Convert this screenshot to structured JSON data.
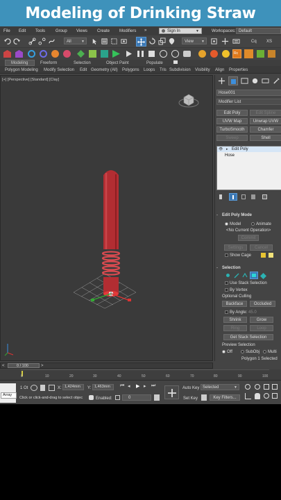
{
  "banner": {
    "title": "Modeling of Drinking Straw"
  },
  "menu": {
    "items": [
      "File",
      "Edit",
      "Tools",
      "Group",
      "Views",
      "Create",
      "Modifiers"
    ],
    "overflow": "»",
    "signin": "Sign In",
    "workspaces_label": "Workspaces:",
    "workspaces_value": "Default"
  },
  "toolbar": {
    "selection_filter": "All",
    "view_dropdown": "View",
    "coord_label": "3",
    "snap_label": "Cq",
    "xs_label": "XS",
    "rc_label": "Rc"
  },
  "ribbon": {
    "tabs": [
      "Modeling",
      "Freeform",
      "Selection",
      "Object Paint",
      "Populate"
    ],
    "subtabs": [
      "Polygon Modeling",
      "Modify Selection",
      "Edit",
      "Geometry (All)",
      "Polygons",
      "Loops",
      "Tris",
      "Subdivision",
      "Visibility",
      "Align",
      "Properties"
    ]
  },
  "viewport": {
    "label": "[+] [Perspective] [Standard] [Clay]",
    "object_color": "#b22d32"
  },
  "panel": {
    "object_name": "Hose001",
    "modifier_list": "Modifier List",
    "modifier_buttons": [
      "Edit Poly",
      "Edit Spline",
      "UVW Map",
      "Unwrap UVW",
      "TurboSmooth",
      "Chamfer",
      "Sweep",
      "Shell"
    ],
    "stack": [
      "Edit Poly",
      "Hose"
    ],
    "edit_poly_mode": {
      "title": "Edit Poly Mode",
      "model": "Model",
      "animate": "Animate",
      "no_op": "<No Current Operation>",
      "commit": "Commit",
      "settings": "Settings",
      "cancel": "Cancel",
      "show_cage": "Show Cage"
    },
    "selection": {
      "title": "Selection",
      "use_stack": "Use Stack Selection",
      "by_vertex": "By Vertex",
      "optional_culling": "Optional Culling",
      "backface": "Backface",
      "occluded": "Occluded",
      "by_angle": "By Angle:",
      "angle_value": "45.0",
      "shrink": "Shrink",
      "grow": "Grow",
      "ring": "Ring",
      "loop": "Loop",
      "get_stack": "Get Stack Selection",
      "preview": "Preview Selection",
      "off": "Off",
      "subobj": "SubObj",
      "multi": "Multi",
      "status": "Polygon 1 Selected"
    }
  },
  "timeline": {
    "frame": "0 / 100",
    "ticks": [
      "0",
      "10",
      "20",
      "30",
      "40",
      "50",
      "60",
      "70",
      "80",
      "90",
      "100"
    ]
  },
  "status": {
    "selected": "1 Ot",
    "script_label": "Array",
    "prompt": "Click or click-and-drag to select objec",
    "x_label": "X:",
    "x_value": "1,424mm",
    "y_label": "Y:",
    "y_value": "1,463mm",
    "enabled": "Enabled:",
    "frame_value": "0",
    "auto_key": "Auto Key",
    "set_key": "Set Key",
    "selected_dropdown": "Selected",
    "key_filters": "Key Filters..."
  }
}
